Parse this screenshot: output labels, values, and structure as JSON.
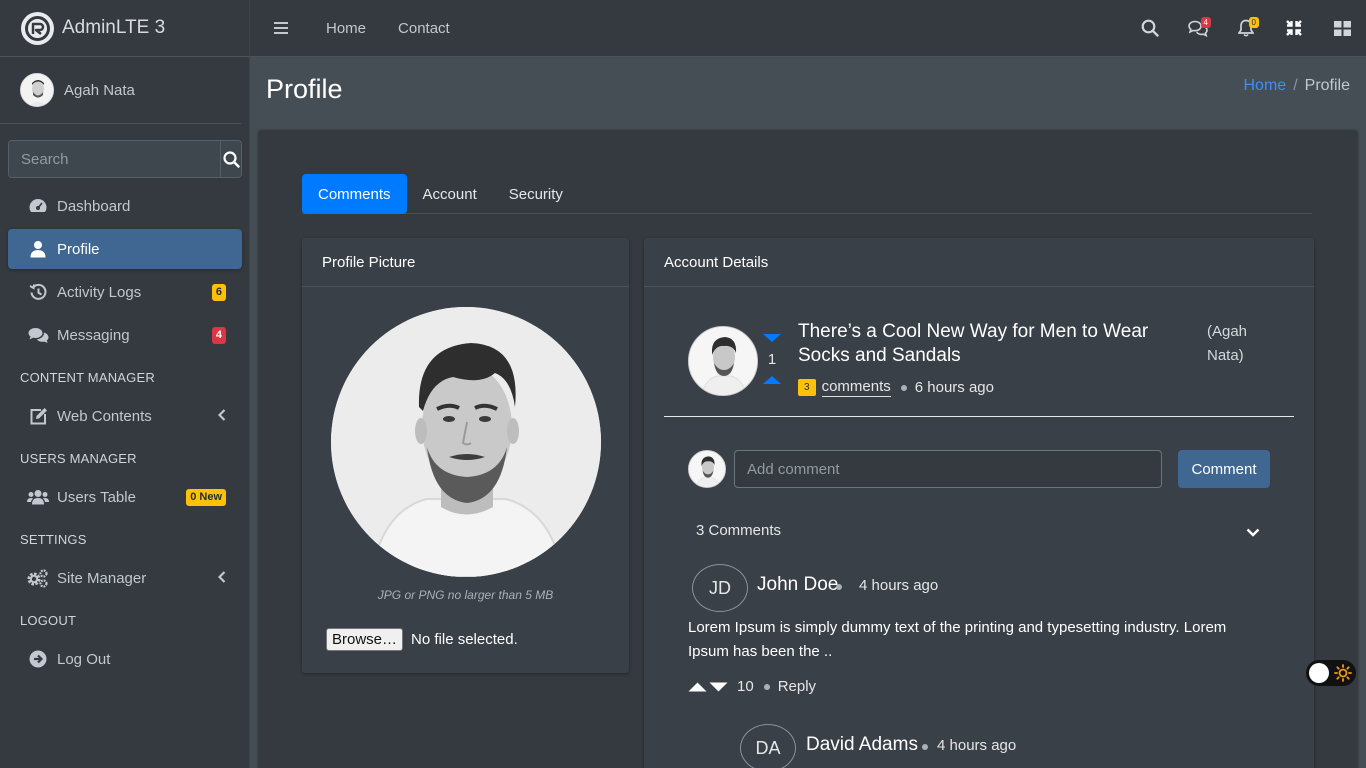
{
  "brand": {
    "name": "AdminLTE 3"
  },
  "user": {
    "name": "Agah Nata"
  },
  "sidebar": {
    "search_placeholder": "Search",
    "items": [
      {
        "label": "Dashboard",
        "icon": "dashboard-icon"
      },
      {
        "label": "Profile",
        "icon": "user-icon",
        "active": true
      },
      {
        "label": "Activity Logs",
        "icon": "history-icon",
        "badge": "6"
      },
      {
        "label": "Messaging",
        "icon": "comments-icon",
        "badge": "4"
      }
    ],
    "content_manager": {
      "header": "CONTENT MANAGER",
      "web_contents": "Web Contents"
    },
    "users_manager": {
      "header": "USERS MANAGER",
      "users_table": "Users Table",
      "badge": "0 New"
    },
    "settings": {
      "header": "SETTINGS",
      "site_manager": "Site Manager"
    },
    "logout": {
      "header": "LOGOUT",
      "log_out": "Log Out"
    }
  },
  "topnav": {
    "home": "Home",
    "contact": "Contact",
    "messages_badge": "4",
    "notifications_badge": "0"
  },
  "page": {
    "title": "Profile",
    "breadcrumb": {
      "home": "Home",
      "current": "Profile"
    }
  },
  "tabs": [
    "Comments",
    "Account",
    "Security"
  ],
  "profile_picture": {
    "title": "Profile Picture",
    "hint": "JPG or PNG no larger than 5 MB",
    "browse_label": "Browse…",
    "file_status": "No file selected."
  },
  "account_details": {
    "title": "Account Details",
    "post": {
      "title": "There’s a Cool New Way for Men to Wear Socks and Sandals",
      "author": "(Agah Nata)",
      "votes": "1",
      "comments_badge": "3",
      "comments_label": "comments",
      "time": "6 hours ago"
    },
    "comment_box": {
      "placeholder": "Add comment",
      "button": "Comment"
    },
    "comments_count_label": "3 Comments",
    "comments": [
      {
        "initials": "JD",
        "name": "John Doe",
        "time": "4 hours ago",
        "text": "Lorem Ipsum is simply dummy text of the printing and typesetting industry. Lorem Ipsum has been the ..",
        "votes": "10",
        "reply": "Reply"
      },
      {
        "initials": "DA",
        "name": "David Adams",
        "time": "4 hours ago"
      }
    ]
  },
  "colors": {
    "primary": "#007bff",
    "sidebar_active": "#3f6791",
    "warning": "#ffc107",
    "danger": "#dc3545"
  }
}
